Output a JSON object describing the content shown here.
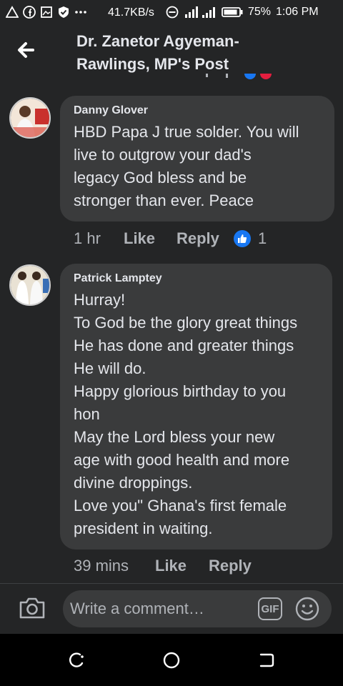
{
  "status_bar": {
    "speed": "41.7KB/s",
    "battery": "75%",
    "time": "1:06 PM",
    "icons": [
      "warning-icon",
      "facebook-icon",
      "gallery-icon",
      "shield-icon",
      "more-dots-icon",
      "do-not-disturb-icon",
      "signal-icon",
      "battery-icon"
    ]
  },
  "header": {
    "title_line1": "Dr. Zanetor Agyeman-",
    "title_line2": "Rawlings, MP's Post",
    "back_icon": "arrow-left-icon"
  },
  "comments": [
    {
      "author": "Danny Glover",
      "lines": [
        "HBD Papa J true solder. You will",
        "live to outgrow your dad's",
        "legacy God bless and be",
        "stronger than ever. Peace"
      ],
      "time": "1 hr",
      "like_label": "Like",
      "reply_label": "Reply",
      "reaction_count": "1"
    },
    {
      "author": "Patrick Lamptey",
      "lines": [
        "Hurray!",
        "To God be the glory great things",
        "He has done and greater things",
        "He will do.",
        "Happy glorious birthday to you",
        "hon",
        "May the Lord bless your new",
        "age with good health and more",
        "divine droppings.",
        "Love you\" Ghana's first female",
        "president in waiting."
      ],
      "time": "39 mins",
      "like_label": "Like",
      "reply_label": "Reply"
    }
  ],
  "composer": {
    "placeholder": "Write a comment…",
    "gif_label": "GIF"
  },
  "colors": {
    "background": "#242526",
    "bubble": "#3a3b3c",
    "text": "#e4e6eb",
    "secondary": "#b0b3b8",
    "like_blue": "#1877f2"
  }
}
